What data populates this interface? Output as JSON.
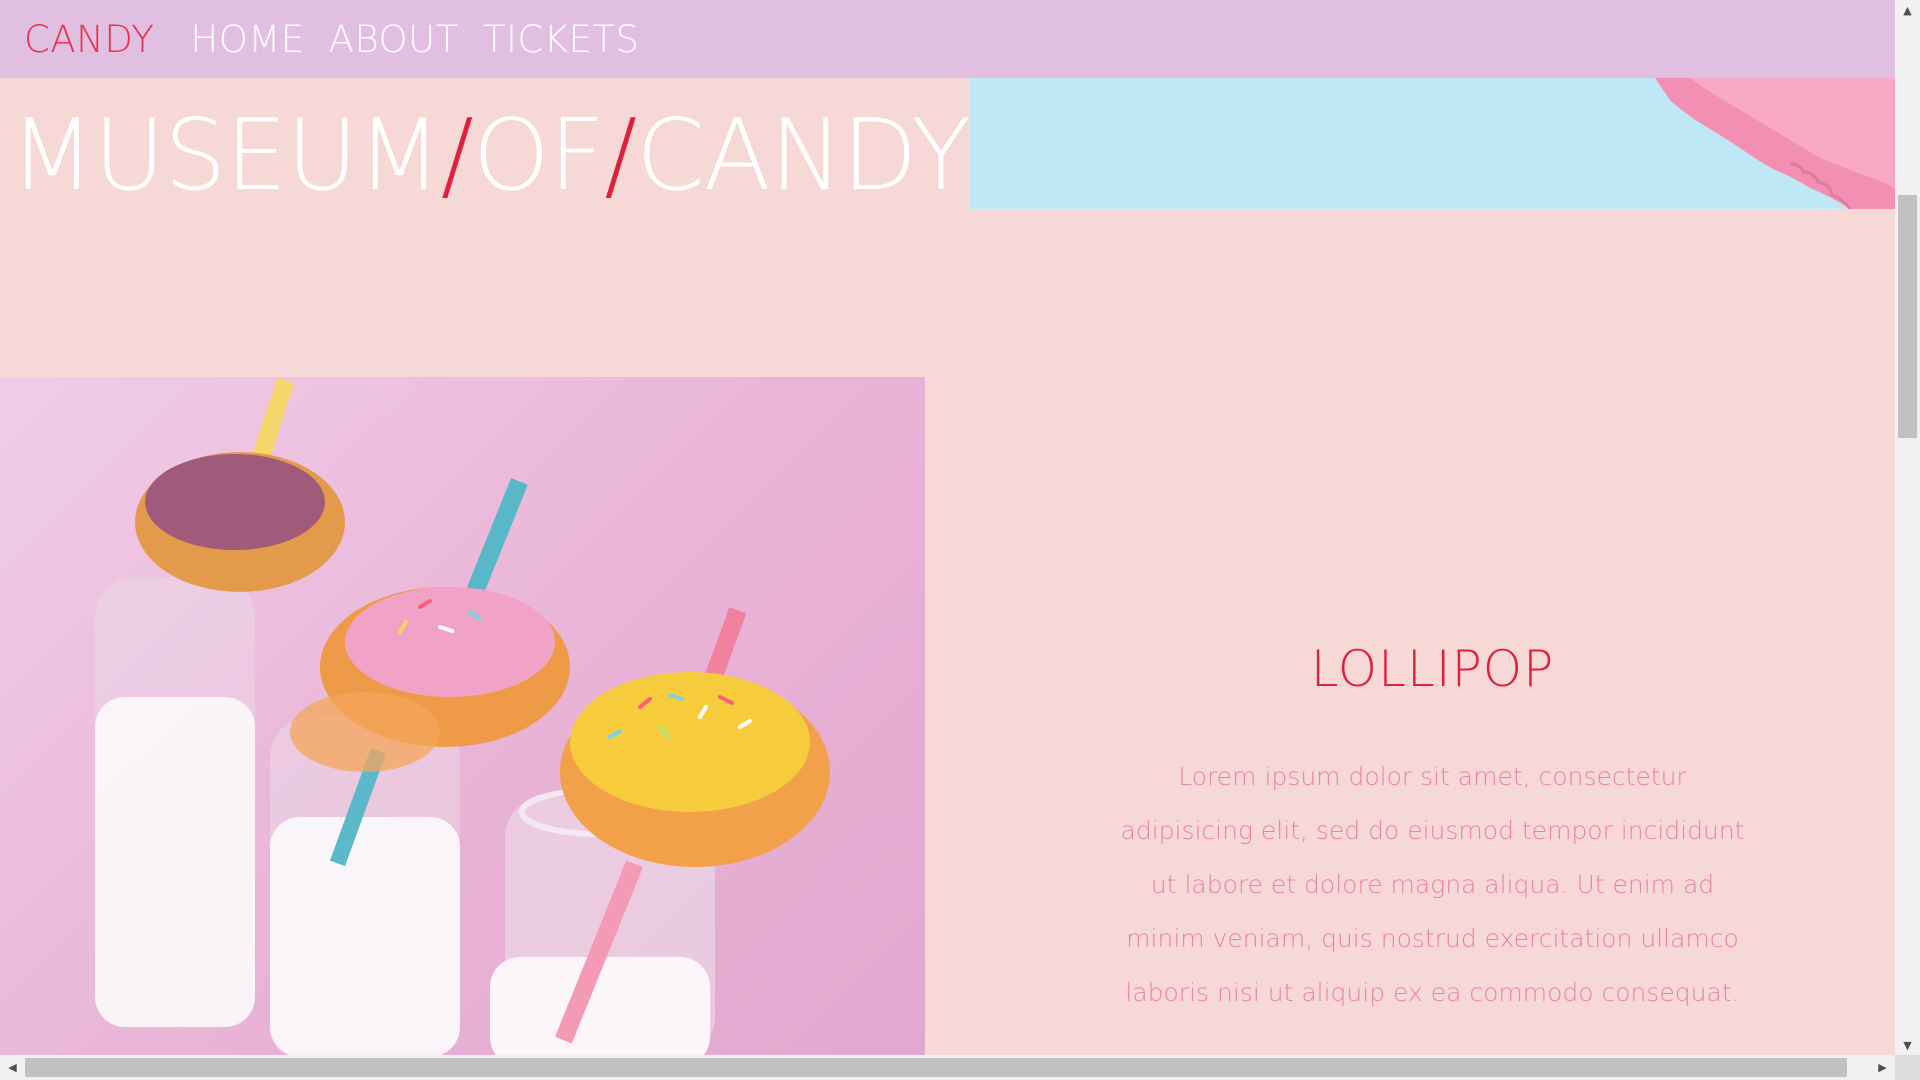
{
  "navbar": {
    "brand": "CANDY",
    "links": [
      "HOME",
      "ABOUT",
      "TICKETS"
    ]
  },
  "hero": {
    "title_parts": [
      "MUSEUM",
      "/",
      "OF",
      "/",
      "CANDY"
    ]
  },
  "section": {
    "heading": "LOLLIPOP",
    "body": "Lorem ipsum dolor sit amet, consectetur adipisicing elit, sed do eiusmod tempor incididunt ut labore et dolore magna aliqua. Ut enim ad minim veniam, quis nostrud exercitation ullamco laboris nisi ut aliquip ex ea commodo consequat."
  },
  "icons": {
    "scroll_up": "triangle-up-icon",
    "scroll_down": "triangle-down-icon",
    "scroll_left": "triangle-left-icon",
    "scroll_right": "triangle-right-icon"
  },
  "colors": {
    "navbar_bg": "#e1bfe0",
    "page_bg": "#f6d9d6",
    "accent_red": "#e01f3d",
    "body_text_pink": "#ea83a0",
    "banner_blue": "#bfe8f6"
  }
}
